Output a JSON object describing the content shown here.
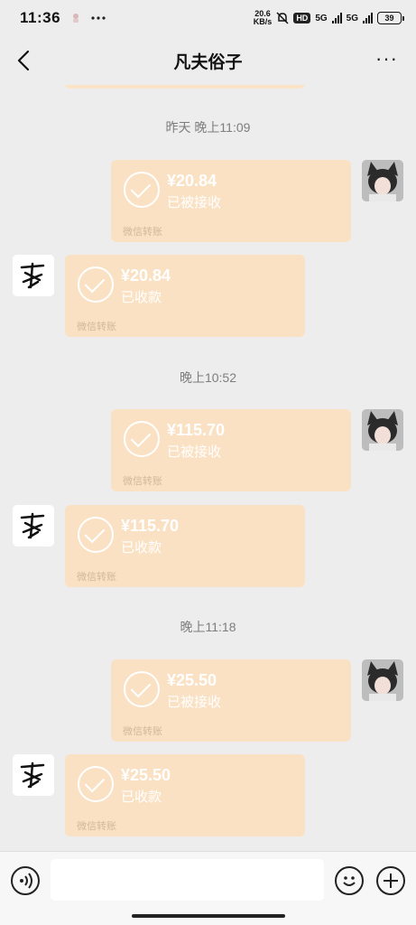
{
  "status_bar": {
    "time": "11:36",
    "speed_value": "20.6",
    "speed_unit": "KB/s",
    "hd_label": "HD",
    "sig1_label": "5G",
    "sig2_label": "5G",
    "battery": "39"
  },
  "nav": {
    "title": "凡夫俗子",
    "more": "···"
  },
  "timestamps": [
    "昨天 晚上11:09",
    "晚上10:52",
    "晚上11:18"
  ],
  "transfers": [
    {
      "amount": "¥20.84",
      "status": "已被接收",
      "footer": "微信转账"
    },
    {
      "amount": "¥20.84",
      "status": "已收款",
      "footer": "微信转账"
    },
    {
      "amount": "¥115.70",
      "status": "已被接收",
      "footer": "微信转账"
    },
    {
      "amount": "¥115.70",
      "status": "已收款",
      "footer": "微信转账"
    },
    {
      "amount": "¥25.50",
      "status": "已被接收",
      "footer": "微信转账"
    },
    {
      "amount": "¥25.50",
      "status": "已收款",
      "footer": "微信转账"
    }
  ],
  "colors": {
    "bubble": "#fbe1c3",
    "background": "#ededed"
  }
}
